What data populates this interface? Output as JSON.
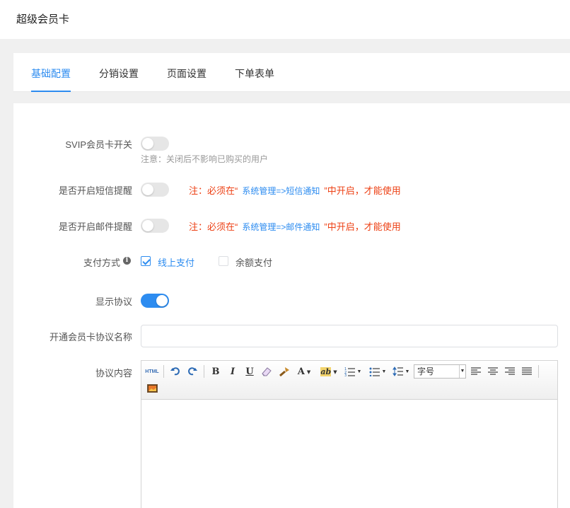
{
  "header": {
    "title": "超级会员卡"
  },
  "tabs": [
    {
      "label": "基础配置",
      "active": true
    },
    {
      "label": "分销设置",
      "active": false
    },
    {
      "label": "页面设置",
      "active": false
    },
    {
      "label": "下单表单",
      "active": false
    }
  ],
  "form": {
    "svip_switch": {
      "label": "SVIP会员卡开关",
      "on": false,
      "hint": "注意：关闭后不影响已购买的用户"
    },
    "sms_reminder": {
      "label": "是否开启短信提醒",
      "on": false,
      "warn_prefix": "注：必须在“",
      "warn_link": "系统管理=>短信通知",
      "warn_suffix": "”中开启，才能使用"
    },
    "email_reminder": {
      "label": "是否开启邮件提醒",
      "on": false,
      "warn_prefix": "注：必须在“",
      "warn_link": "系统管理=>邮件通知",
      "warn_suffix": "”中开启，才能使用"
    },
    "payment": {
      "label": "支付方式",
      "info_icon": "i",
      "options": [
        {
          "label": "线上支付",
          "checked": true
        },
        {
          "label": "余额支付",
          "checked": false
        }
      ]
    },
    "show_agreement": {
      "label": "显示协议",
      "on": true
    },
    "agreement_name": {
      "label": "开通会员卡协议名称",
      "value": ""
    },
    "agreement_content": {
      "label": "协议内容"
    }
  },
  "editor": {
    "html_label": "HTML",
    "bold": "B",
    "italic": "I",
    "underline": "U",
    "font_color": "A",
    "highlight": "ab",
    "font_size_placeholder": "字号"
  },
  "colors": {
    "accent": "#2d8cf0",
    "warning": "#ed4014"
  }
}
